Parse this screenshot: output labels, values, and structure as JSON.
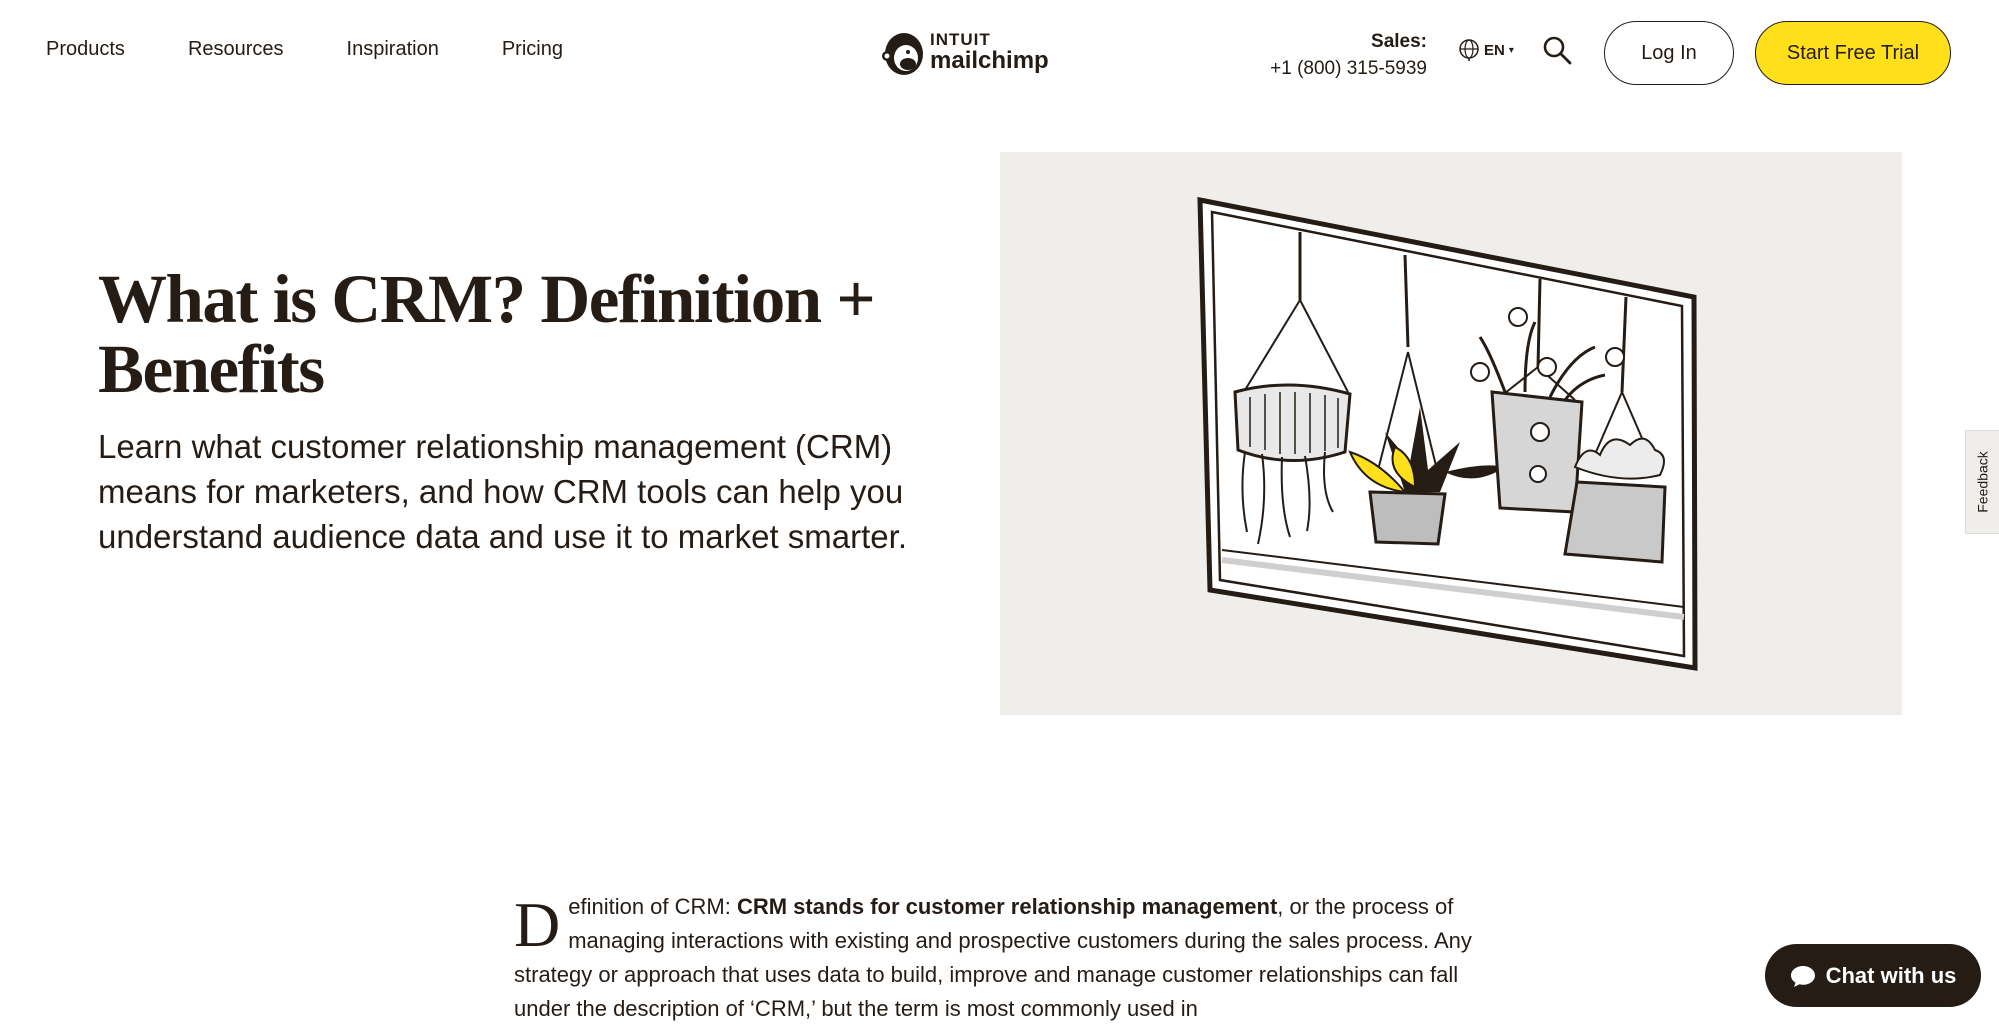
{
  "header": {
    "nav": [
      "Products",
      "Resources",
      "Inspiration",
      "Pricing"
    ],
    "logo": {
      "intuit": "INTUIT",
      "brand": "mailchimp"
    },
    "sales_label": "Sales:",
    "sales_phone": "+1 (800) 315-5939",
    "language": "EN",
    "login_label": "Log In",
    "trial_label": "Start Free Trial",
    "icons": {
      "search": "search-icon",
      "globe": "globe-icon",
      "caret": "chevron-down-icon"
    }
  },
  "hero": {
    "title": "What is CRM? Definition + Benefits",
    "subtitle": "Learn what customer relationship management (CRM) means for marketers, and how CRM tools can help you understand audience data and use it to market smarter."
  },
  "feedback_label": "Feedback",
  "article": {
    "dropcap": "D",
    "intro_start": "efinition of CRM: ",
    "intro_bold": "CRM stands for customer relationship management",
    "intro_rest": ", or the process of managing interactions with existing and prospective customers during the sales process. Any strategy or approach that uses data to build, improve and manage customer relationships can fall under the description of ‘CRM,’ but the term is most commonly used in"
  },
  "chat_label": "Chat with us",
  "colors": {
    "accent": "#ffe01b",
    "ink": "#241c15",
    "image_bg": "#efeeea"
  }
}
